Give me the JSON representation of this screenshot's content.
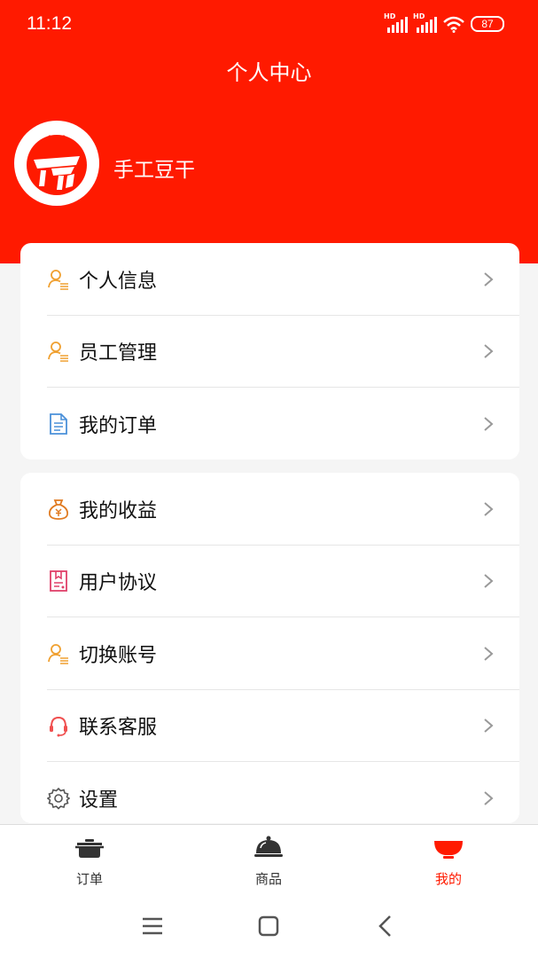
{
  "status_bar": {
    "time": "11:12",
    "hd1": "HD",
    "hd2": "HD",
    "battery": "87"
  },
  "header": {
    "title": "个人中心"
  },
  "user": {
    "name": "手工豆干"
  },
  "menu_group_1": [
    {
      "label": "个人信息",
      "icon": "user-list-icon"
    },
    {
      "label": "员工管理",
      "icon": "user-list-icon"
    },
    {
      "label": "我的订单",
      "icon": "document-icon"
    }
  ],
  "menu_group_2": [
    {
      "label": "我的收益",
      "icon": "money-bag-icon"
    },
    {
      "label": "用户协议",
      "icon": "agreement-icon"
    },
    {
      "label": "切换账号",
      "icon": "user-list-icon"
    },
    {
      "label": "联系客服",
      "icon": "headset-icon"
    },
    {
      "label": "设置",
      "icon": "gear-icon"
    }
  ],
  "tabbar": {
    "items": [
      {
        "label": "订单",
        "icon": "pot-icon"
      },
      {
        "label": "商品",
        "icon": "cloche-icon"
      },
      {
        "label": "我的",
        "icon": "bowl-icon"
      }
    ],
    "active": "我的"
  },
  "colors": {
    "brand": "#ff1a00",
    "icon_orange": "#f0a030",
    "icon_blue": "#4a90d9",
    "icon_pink": "#e0406a",
    "icon_red": "#f05050"
  }
}
